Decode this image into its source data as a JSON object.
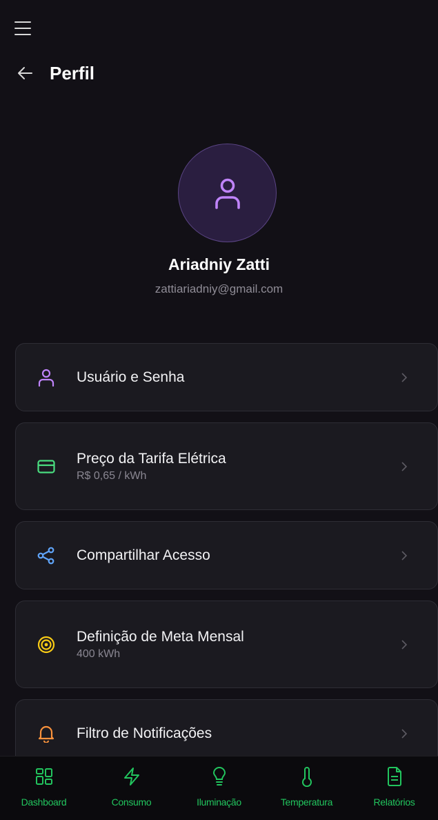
{
  "header": {
    "menu_icon": "hamburger-menu-icon",
    "back_icon": "arrow-left-icon",
    "title": "Perfil"
  },
  "profile": {
    "avatar_icon": "user-icon",
    "name": "Ariadniy Zatti",
    "email": "zattiariadniy@gmail.com"
  },
  "settings": [
    {
      "label": "Usuário e Senha",
      "sub": "",
      "icon": "user-icon",
      "color": "#c084fc"
    },
    {
      "label": "Preço da Tarifa Elétrica",
      "sub": "R$ 0,65 / kWh",
      "icon": "credit-card-icon",
      "color": "#4ade80"
    },
    {
      "label": "Compartilhar Acesso",
      "sub": "",
      "icon": "share-icon",
      "color": "#60a5fa"
    },
    {
      "label": "Definição de Meta Mensal",
      "sub": "400 kWh",
      "icon": "target-icon",
      "color": "#facc15"
    },
    {
      "label": "Filtro de Notificações",
      "sub": "",
      "icon": "bell-icon",
      "color": "#fb923c"
    }
  ],
  "bottom_nav": [
    {
      "label": "Dashboard",
      "icon": "dashboard-grid-icon"
    },
    {
      "label": "Consumo",
      "icon": "lightning-icon"
    },
    {
      "label": "Iluminação",
      "icon": "lightbulb-icon"
    },
    {
      "label": "Temperatura",
      "icon": "thermometer-icon"
    },
    {
      "label": "Relatórios",
      "icon": "report-file-icon"
    }
  ],
  "colors": {
    "background": "#121016",
    "card": "#1b1a20",
    "accent_purple": "#c084fc",
    "nav_green": "#22c55e"
  }
}
